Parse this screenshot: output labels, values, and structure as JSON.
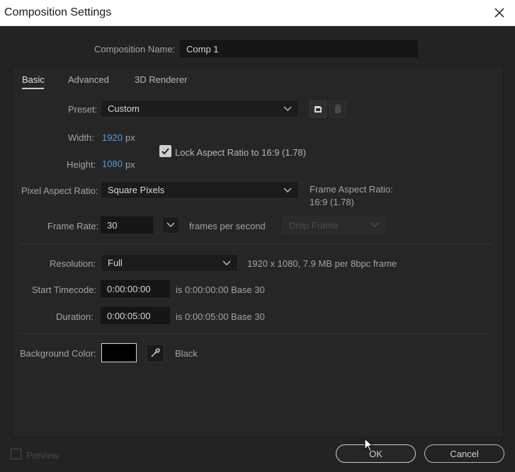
{
  "window": {
    "title": "Composition Settings"
  },
  "comp_name": {
    "label": "Composition Name:",
    "value": "Comp 1"
  },
  "tabs": [
    {
      "label": "Basic"
    },
    {
      "label": "Advanced"
    },
    {
      "label": "3D Renderer"
    }
  ],
  "preset": {
    "label": "Preset:",
    "value": "Custom"
  },
  "width": {
    "label": "Width:",
    "value": "1920",
    "unit": "px"
  },
  "height": {
    "label": "Height:",
    "value": "1080",
    "unit": "px"
  },
  "lock_aspect": {
    "label": "Lock Aspect Ratio to 16:9 (1.78)",
    "checked": true
  },
  "pixel_aspect": {
    "label": "Pixel Aspect Ratio:",
    "value": "Square Pixels"
  },
  "frame_aspect": {
    "label": "Frame Aspect Ratio:",
    "value": "16:9 (1.78)"
  },
  "frame_rate": {
    "label": "Frame Rate:",
    "value": "30",
    "unit": "frames per second",
    "drop_frame": "Drop Frame"
  },
  "resolution": {
    "label": "Resolution:",
    "value": "Full",
    "info": "1920 x 1080, 7.9 MB per 8bpc frame"
  },
  "start_timecode": {
    "label": "Start Timecode:",
    "value": "0:00:00:00",
    "info": "is 0:00:00:00  Base 30"
  },
  "duration": {
    "label": "Duration:",
    "value": "0:00:05:00",
    "info": "is 0:00:05:00  Base 30"
  },
  "background": {
    "label": "Background Color:",
    "color": "#000000",
    "name": "Black"
  },
  "preview": {
    "label": "Preview",
    "checked": false
  },
  "buttons": {
    "ok": "OK",
    "cancel": "Cancel"
  }
}
